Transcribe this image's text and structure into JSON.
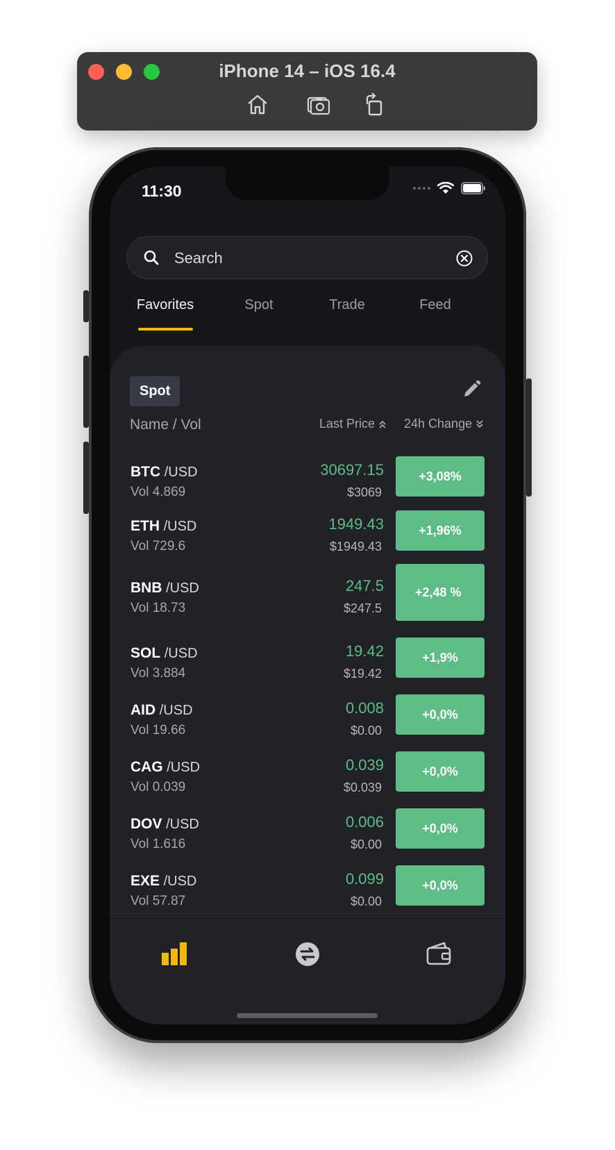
{
  "simulator": {
    "title": "iPhone 14 – iOS 16.4",
    "tools": [
      "home-icon",
      "screenshot-icon",
      "rotate-icon"
    ]
  },
  "status": {
    "time": "11:30"
  },
  "search": {
    "placeholder": "Search"
  },
  "tabs": [
    {
      "label": "Favorites",
      "active": true
    },
    {
      "label": "Spot",
      "active": false
    },
    {
      "label": "Trade",
      "active": false
    },
    {
      "label": "Feed",
      "active": false
    }
  ],
  "panel": {
    "chip": "Spot",
    "columns": {
      "name": "Name / Vol",
      "price": "Last Price",
      "change": "24h Change"
    }
  },
  "rows": [
    {
      "base": "BTC",
      "quote": "/USD",
      "vol": "Vol 4.869",
      "price": "30697.15",
      "usd": "$3069",
      "change": "+3,08%"
    },
    {
      "base": "ETH",
      "quote": "/USD",
      "vol": "Vol 729.6",
      "price": "1949.43",
      "usd": "$1949.43",
      "change": "+1,96%"
    },
    {
      "base": "BNB",
      "quote": "/USD",
      "vol": "Vol 18.73",
      "price": "247.5",
      "usd": "$247.5",
      "change": "+2,48 %"
    },
    {
      "base": "SOL",
      "quote": "/USD",
      "vol": "Vol 3.884",
      "price": "19.42",
      "usd": "$19.42",
      "change": "+1,9%"
    },
    {
      "base": "AID",
      "quote": "/USD",
      "vol": "Vol 19.66",
      "price": "0.008",
      "usd": "$0.00",
      "change": "+0,0%"
    },
    {
      "base": "CAG",
      "quote": "/USD",
      "vol": "Vol 0.039",
      "price": "0.039",
      "usd": "$0.039",
      "change": "+0,0%"
    },
    {
      "base": "DOV",
      "quote": "/USD",
      "vol": "Vol 1.616",
      "price": "0.006",
      "usd": "$0.00",
      "change": "+0,0%"
    },
    {
      "base": "EXE",
      "quote": "/USD",
      "vol": "Vol 57.87",
      "price": "0.099",
      "usd": "$0.00",
      "change": "+0,0%"
    }
  ],
  "bottom_nav": [
    {
      "icon": "market-chart-icon",
      "active": true
    },
    {
      "icon": "swap-icon",
      "active": false
    },
    {
      "icon": "wallet-icon",
      "active": false
    }
  ],
  "colors": {
    "accent": "#f0b90b",
    "positive": "#5ebc86",
    "background": "#15171b",
    "panel": "#202227"
  }
}
